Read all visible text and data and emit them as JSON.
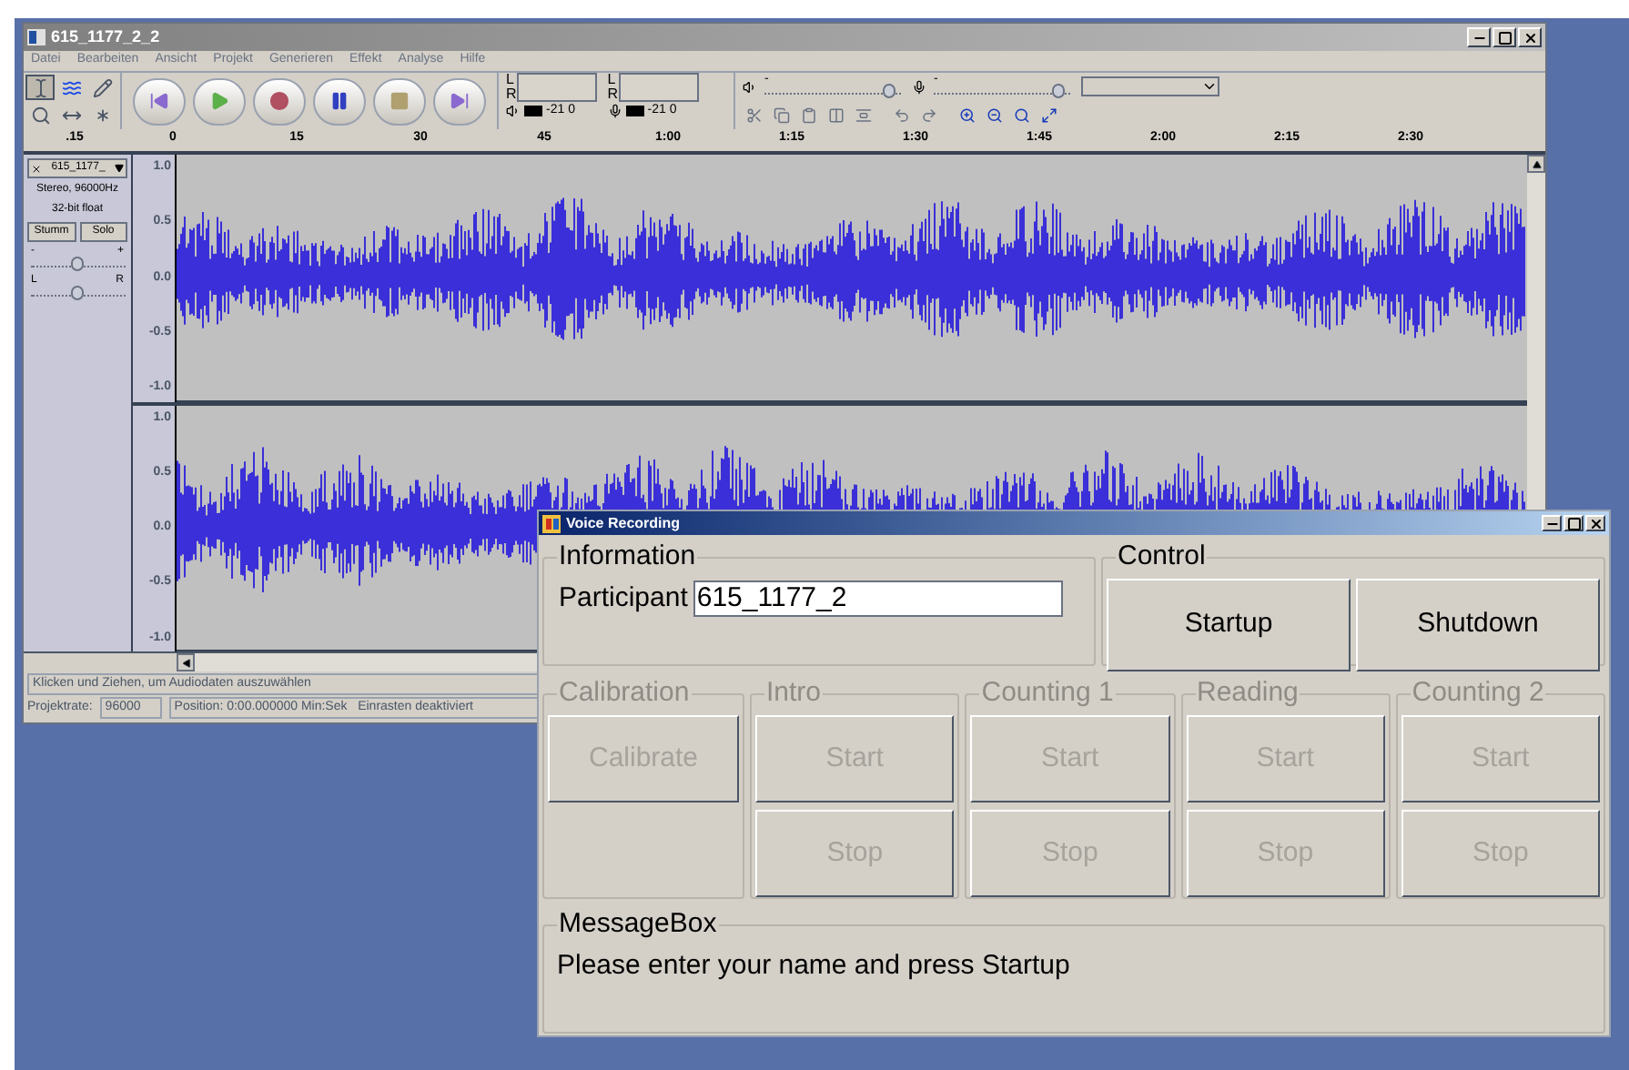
{
  "audio_editor": {
    "title": "615_1177_2_2",
    "menu": [
      "Datei",
      "Bearbeiten",
      "Ansicht",
      "Projekt",
      "Generieren",
      "Effekt",
      "Analyse",
      "Hilfe"
    ],
    "tools": [
      {
        "kind": "ibeam",
        "selected": true
      },
      {
        "kind": "envelope",
        "selected": false
      },
      {
        "kind": "pencil",
        "selected": false
      },
      {
        "kind": "zoom",
        "selected": false
      },
      {
        "kind": "timeshift",
        "selected": false
      },
      {
        "kind": "multi",
        "selected": false
      }
    ],
    "transport": [
      {
        "kind": "skip-start"
      },
      {
        "kind": "play"
      },
      {
        "kind": "record"
      },
      {
        "kind": "pause"
      },
      {
        "kind": "stop"
      },
      {
        "kind": "skip-end"
      }
    ],
    "meters": [
      {
        "kind": "playback",
        "channels": [
          "L",
          "R"
        ],
        "scale": [
          "-21",
          "0"
        ]
      },
      {
        "kind": "record",
        "channels": [
          "L",
          "R"
        ],
        "scale": [
          "-21",
          "0"
        ]
      }
    ],
    "mixer": [
      {
        "kind": "playback",
        "min": "-",
        "level": 0.92
      },
      {
        "kind": "record",
        "min": "-",
        "level": 0.92
      }
    ],
    "edit_tools": [
      {
        "kind": "cut"
      },
      {
        "kind": "copy"
      },
      {
        "kind": "paste"
      },
      {
        "kind": "trim"
      },
      {
        "kind": "silence"
      },
      {
        "kind": "undo"
      },
      {
        "kind": "redo"
      },
      {
        "kind": "zoom-in"
      },
      {
        "kind": "zoom-out"
      },
      {
        "kind": "fit"
      },
      {
        "kind": "zoom-toggle"
      }
    ],
    "ruler": [
      ".15",
      "0",
      "15",
      "30",
      "45",
      "1:00",
      "1:15",
      "1:30",
      "1:45",
      "2:00",
      "2:15",
      "2:30"
    ],
    "track": {
      "name": "615_1177_",
      "info": [
        "Stereo, 96000Hz",
        "32-bit float"
      ],
      "buttons": [
        "Stumm",
        "Solo"
      ],
      "gain": {
        "min": "-",
        "max": "+",
        "level": 0.5
      },
      "pan": {
        "min": "L",
        "max": "R",
        "level": 0.5
      },
      "channels": [
        {
          "scale": [
            "1.0",
            "0.5",
            "0.0",
            "-0.5",
            "-1.0"
          ]
        },
        {
          "scale": [
            "1.0",
            "0.5",
            "0.0",
            "-0.5",
            "-1.0"
          ]
        }
      ]
    },
    "status": "Klicken und Ziehen, um Audiodaten auszuwählen",
    "rate_label": "Projektrate:",
    "rate_value": "96000",
    "position": "Position: 0:00.000000 Min:Sek   Einrasten deaktiviert"
  },
  "voice_recording": {
    "title": "Voice Recording",
    "information": {
      "legend": "Information",
      "participant_label": "Participant",
      "participant_value": "615_1177_2"
    },
    "control": {
      "legend": "Control",
      "buttons": [
        {
          "label": "Startup",
          "disabled": false
        },
        {
          "label": "Shutdown",
          "disabled": false
        }
      ]
    },
    "stages": [
      {
        "legend": "Calibration",
        "disabled": true,
        "buttons": [
          {
            "label": "Calibrate",
            "disabled": true
          }
        ]
      },
      {
        "legend": "Intro",
        "disabled": true,
        "buttons": [
          {
            "label": "Start",
            "disabled": true
          },
          {
            "label": "Stop",
            "disabled": true
          }
        ]
      },
      {
        "legend": "Counting 1",
        "disabled": true,
        "buttons": [
          {
            "label": "Start",
            "disabled": true
          },
          {
            "label": "Stop",
            "disabled": true
          }
        ]
      },
      {
        "legend": "Reading",
        "disabled": true,
        "buttons": [
          {
            "label": "Start",
            "disabled": true
          },
          {
            "label": "Stop",
            "disabled": true
          }
        ]
      },
      {
        "legend": "Counting 2",
        "disabled": true,
        "buttons": [
          {
            "label": "Start",
            "disabled": true
          },
          {
            "label": "Stop",
            "disabled": true
          }
        ]
      }
    ],
    "message_box": {
      "legend": "MessageBox",
      "message": "Please enter your name and press Startup"
    }
  }
}
